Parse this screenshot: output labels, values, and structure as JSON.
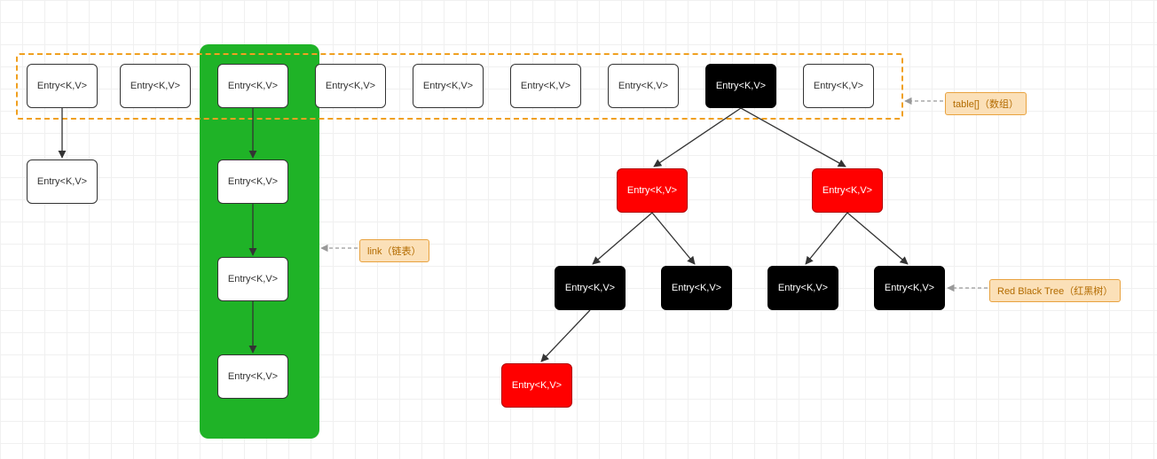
{
  "entry_label": "Entry<K,V>",
  "callouts": {
    "table": "table[]（数组）",
    "link": "link（链表）",
    "rbtree": "Red Black Tree（红黑树）"
  },
  "colors": {
    "dashed_border": "#f0a020",
    "green_band": "#1fb327",
    "black_node": "#000000",
    "red_node": "#ff0000",
    "callout_bg": "#fbe0b8",
    "callout_border": "#e8a23f"
  },
  "structure": {
    "table_slots": 9,
    "slot0": {
      "style": "white",
      "bucket_type": "linked_list",
      "bucket_length": 1
    },
    "slot2": {
      "style": "white",
      "bucket_type": "linked_list",
      "bucket_length": 3,
      "highlighted_green": true
    },
    "slot7": {
      "style": "black",
      "bucket_type": "red_black_tree",
      "tree": {
        "root": "black",
        "L": {
          "c": "red",
          "L": {
            "c": "black",
            "L": {
              "c": "red"
            }
          },
          "R": {
            "c": "black"
          }
        },
        "R": {
          "c": "red",
          "L": {
            "c": "black"
          },
          "R": {
            "c": "black"
          }
        }
      }
    }
  }
}
